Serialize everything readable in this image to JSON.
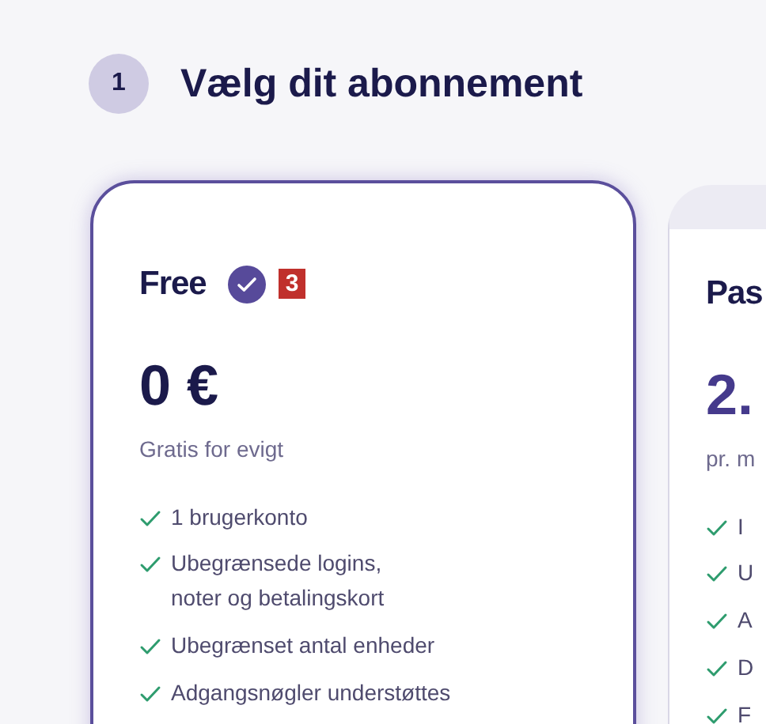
{
  "step": {
    "number": "1",
    "title": "Vælg dit abonnement"
  },
  "plans": [
    {
      "name": "Free",
      "selected": true,
      "marker": "3",
      "price": "0 €",
      "period": "Gratis for evigt",
      "features": [
        "1 brugerkonto",
        "Ubegrænsede logins,\nnoter og betalingskort",
        "Ubegrænset antal enheder",
        "Adgangsnøgler understøttes"
      ]
    },
    {
      "name": "Pas",
      "selected": false,
      "price": "2.",
      "period": "pr. m",
      "features": [
        "I",
        "U",
        "A",
        "D",
        "F"
      ]
    }
  ]
}
